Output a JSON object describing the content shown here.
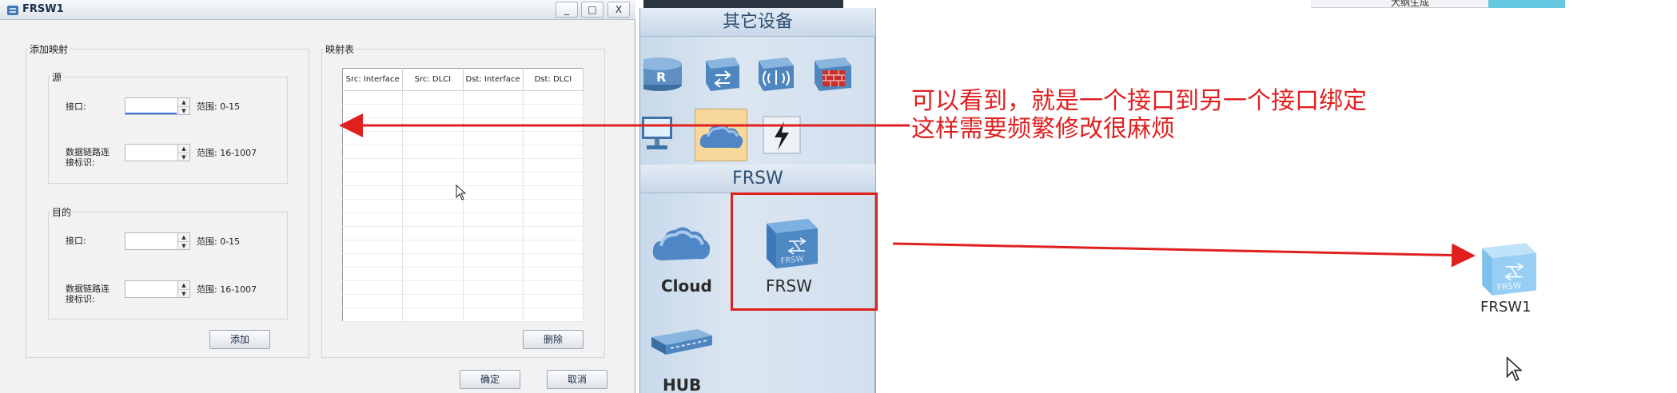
{
  "window": {
    "title": "FRSW1",
    "minimize": "_",
    "maximize": "□",
    "close": "X"
  },
  "add_mapping": {
    "legend": "添加映射",
    "source": {
      "legend": "源",
      "interface_label": "接口:",
      "interface_value": "",
      "interface_range": "范围: 0-15",
      "dlci_label_line1": "数据链路连",
      "dlci_label_line2": "接标识:",
      "dlci_value": "",
      "dlci_range": "范围: 16-1007"
    },
    "destination": {
      "legend": "目的",
      "interface_label": "接口:",
      "interface_value": "",
      "interface_range": "范围: 0-15",
      "dlci_label_line1": "数据链路连",
      "dlci_label_line2": "接标识:",
      "dlci_value": "",
      "dlci_range": "范围: 16-1007"
    },
    "add_button": "添加"
  },
  "mapping_table": {
    "legend": "映射表",
    "columns": [
      "Src: Interface",
      "Src: DLCI",
      "Dst: Interface",
      "Dst: DLCI"
    ],
    "rows": [],
    "delete_button": "删除"
  },
  "footer": {
    "ok_button": "确定",
    "cancel_button": "取消"
  },
  "palette": {
    "other_devices_header": "其它设备",
    "frsw_header": "FRSW",
    "other_devices_icons": [
      "router-icon",
      "switch-icon",
      "wireless-ap-icon",
      "firewall-icon",
      "pc-icon",
      "cloud-icon",
      "power-icon"
    ],
    "frsw_devices": [
      {
        "label": "Cloud",
        "icon": "cloud-icon"
      },
      {
        "label": "FRSW",
        "icon": "frsw-icon"
      },
      {
        "label": "HUB",
        "icon": "hub-icon"
      }
    ]
  },
  "canvas": {
    "device_label": "FRSW1",
    "device_icon": "frsw-icon",
    "top_item_text": "大纲生成"
  },
  "annotation": {
    "line1": "可以看到，就是一个接口到另一个接口绑定",
    "line2": "这样需要频繁修改很麻烦",
    "color": "#e02020"
  },
  "colors": {
    "palette_bg": "#d2e0ee",
    "palette_header_text": "#2d4d72",
    "annotation_red": "#e02020",
    "frsw_blue": "#4f89c4"
  }
}
